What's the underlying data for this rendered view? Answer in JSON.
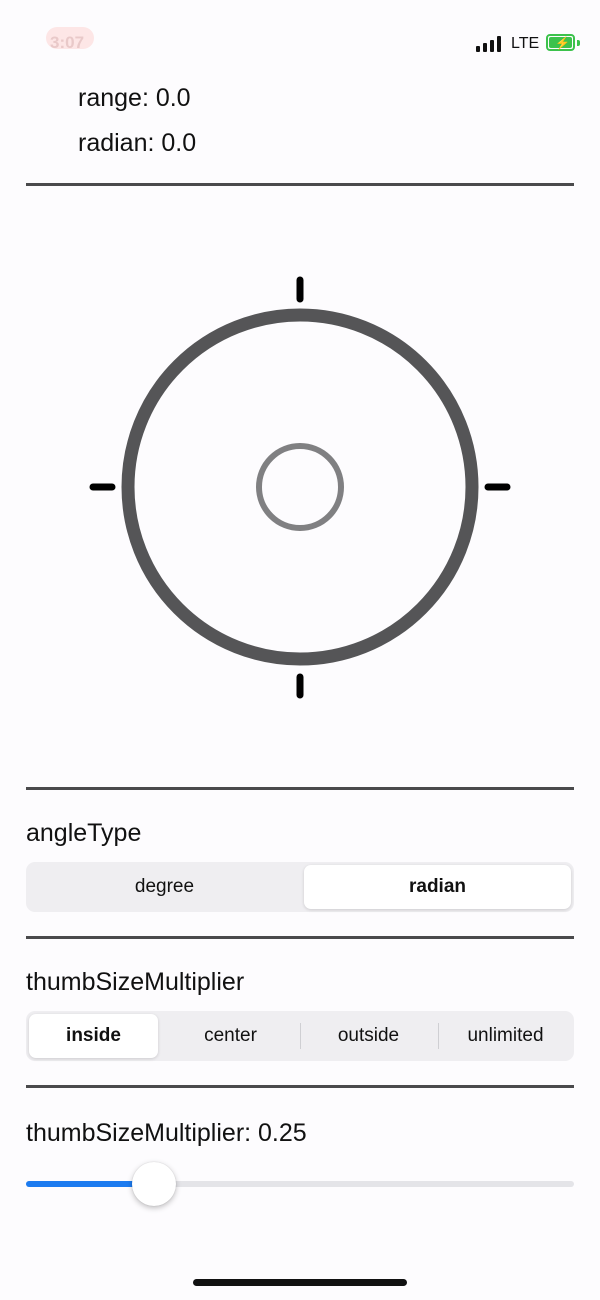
{
  "status_bar": {
    "time": "3:07",
    "network": "LTE"
  },
  "info": {
    "range": "range: 0.0",
    "radian": "radian: 0.0"
  },
  "angle_type": {
    "title": "angleType",
    "options": [
      "degree",
      "radian"
    ],
    "selected": "radian"
  },
  "thumb_size_mode": {
    "title": "thumbSizeMultiplier",
    "options": [
      "inside",
      "center",
      "outside",
      "unlimited"
    ],
    "selected": "inside"
  },
  "thumb_size_slider": {
    "label": "thumbSizeMultiplier: 0.25",
    "value": 0.25,
    "fill_color": "#1c7bf0"
  }
}
